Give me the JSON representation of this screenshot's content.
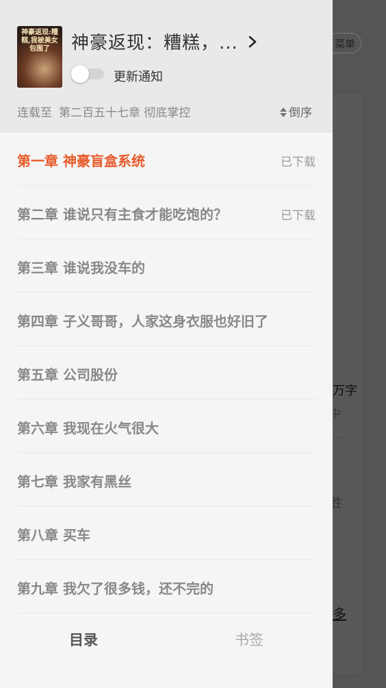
{
  "background": {
    "menu_label": "菜单",
    "text1": "万字",
    "text2": "中",
    "text3": "胜",
    "text4": "多"
  },
  "header": {
    "cover_text": "神豪返现:糟糕,我被美女包围了",
    "title": "神豪返现：糟糕，...",
    "update_label": "更新通知",
    "update_on": false,
    "serial_prefix": "连载至",
    "serial_chapter": "第二百五十七章 彻底掌控",
    "sort_label": "倒序"
  },
  "chapters": [
    {
      "title": "第一章 神豪盲盒系统",
      "status": "已下载",
      "active": true
    },
    {
      "title": "第二章 谁说只有主食才能吃饱的？",
      "status": "已下载",
      "active": false
    },
    {
      "title": "第三章 谁说我没车的",
      "status": "",
      "active": false
    },
    {
      "title": "第四章 子义哥哥，人家这身衣服也好旧了",
      "status": "",
      "active": false
    },
    {
      "title": "第五章 公司股份",
      "status": "",
      "active": false
    },
    {
      "title": "第六章 我现在火气很大",
      "status": "",
      "active": false
    },
    {
      "title": "第七章 我家有黑丝",
      "status": "",
      "active": false
    },
    {
      "title": "第八章 买车",
      "status": "",
      "active": false
    },
    {
      "title": "第九章 我欠了很多钱，还不完的",
      "status": "",
      "active": false
    }
  ],
  "tabs": {
    "toc": "目录",
    "bookmark": "书签"
  },
  "colors": {
    "accent": "#e85a2a",
    "drawer_bg": "#f5f5f5",
    "header_bg": "#e9e9e9"
  }
}
